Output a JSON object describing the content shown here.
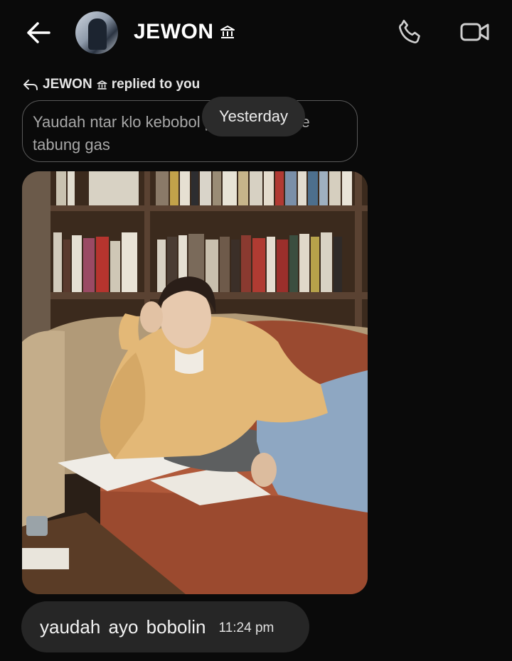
{
  "header": {
    "contact_name": "JEWON",
    "verified_glyph": "⌂"
  },
  "reply": {
    "label_prefix": "JEWON",
    "label_suffix": "replied to you",
    "quoted_text": "Yaudah ntar klo kebobol pindahin aja ke tabung gas"
  },
  "date_separator": "Yesterday",
  "message": {
    "text": "yaudah ayo  bobolin",
    "time": "11:24 pm"
  },
  "icons": {
    "back": "back-arrow-icon",
    "call": "phone-icon",
    "video": "video-camera-icon",
    "reply": "reply-arrow-icon"
  },
  "colors": {
    "background": "#0a0a0a",
    "bubble": "#262626",
    "pill": "#2b2b2b",
    "quote_border": "#5a5a5a"
  }
}
